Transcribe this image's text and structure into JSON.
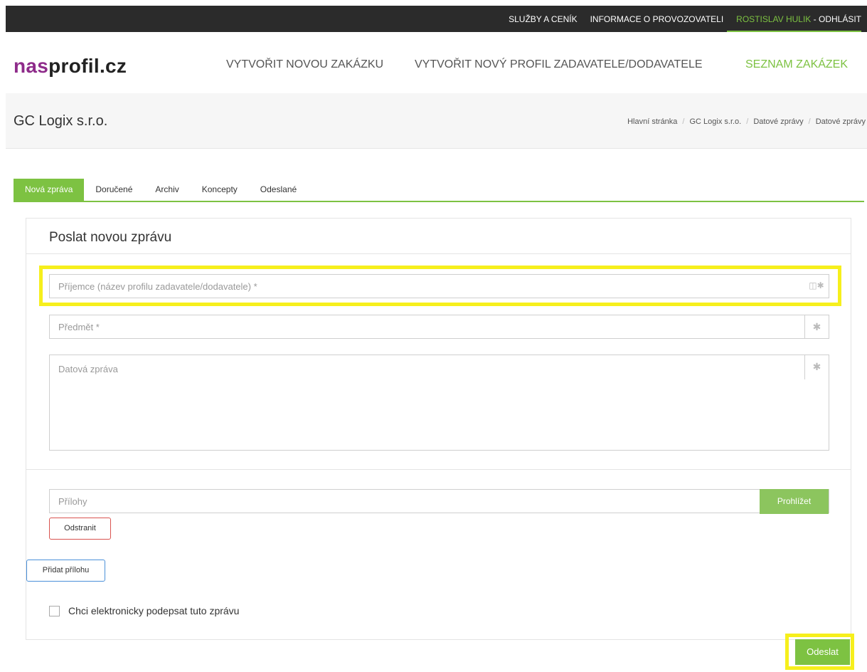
{
  "topbar": {
    "services": "SLUŽBY A CENÍK",
    "operator_info": "INFORMACE O PROVOZOVATELI",
    "user": "ROSTISLAV HULIK",
    "separator": " - ",
    "logout": "ODHLÁSIT"
  },
  "logo": {
    "part1": "nas",
    "part2": "profil.cz"
  },
  "nav": {
    "new_contract": "VYTVOŘIT NOVOU ZAKÁZKU",
    "new_profile": "VYTVOŘIT NOVÝ PROFIL ZADAVATELE/DODAVATELE",
    "contract_list": "SEZNAM ZAKÁZEK"
  },
  "header": {
    "title": "GC Logix s.r.o.",
    "breadcrumbs": [
      "Hlavní stránka",
      "GC Logix s.r.o.",
      "Datové zprávy",
      "Datové zprávy"
    ]
  },
  "tabs": [
    "Nová zpráva",
    "Doručené",
    "Archiv",
    "Koncepty",
    "Odeslané"
  ],
  "form": {
    "title": "Poslat novou zprávu",
    "recipient_placeholder": "Příjemce (název profilu zadavatele/dodavatele) *",
    "subject_placeholder": "Předmět *",
    "message_placeholder": "Datová zpráva",
    "attachments_placeholder": "Přílohy",
    "browse": "Prohlížet",
    "remove": "Odstranit",
    "add_attachment": "Přidat přílohu",
    "sign_label": "Chci elektronicky podepsat tuto zprávu",
    "sign_checked": false,
    "send": "Odeslat"
  },
  "colors": {
    "accent": "#7dc242",
    "logo": "#8e2b8a",
    "highlight": "#f6ef1c"
  },
  "icons": {
    "required": "asterisk-icon",
    "contact": "address-book-icon"
  }
}
